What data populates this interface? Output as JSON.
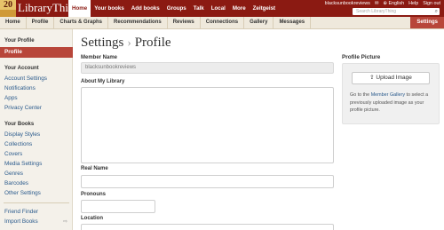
{
  "logo": {
    "number": "20",
    "text": "LibraryThing"
  },
  "topnav": [
    {
      "label": "Home",
      "active": true
    },
    {
      "label": "Your books",
      "active": false
    },
    {
      "label": "Add books",
      "active": false
    },
    {
      "label": "Groups",
      "active": false
    },
    {
      "label": "Talk",
      "active": false
    },
    {
      "label": "Local",
      "active": false
    },
    {
      "label": "More",
      "active": false
    },
    {
      "label": "Zeitgeist",
      "active": false
    }
  ],
  "user_links": {
    "username": "blacksunbookreviews",
    "mail": "✉",
    "language": "English",
    "help": "Help",
    "signout": "Sign out"
  },
  "search": {
    "placeholder": "Search LibraryThing",
    "icon": "search-icon"
  },
  "subnav": [
    "Home",
    "Profile",
    "Charts & Graphs",
    "Recommendations",
    "Reviews",
    "Connections",
    "Gallery",
    "Messages"
  ],
  "subnav_active": "Settings",
  "sidebar": {
    "your_profile": "Your Profile",
    "profile_active": "Profile",
    "your_account": "Your Account",
    "account_items": [
      "Account Settings",
      "Notifications",
      "Apps",
      "Privacy Center"
    ],
    "your_books": "Your Books",
    "books_items": [
      "Display Styles",
      "Collections",
      "Covers",
      "Media Settings",
      "Genres",
      "Barcodes",
      "Other Settings"
    ],
    "tools_items": [
      "Friend Finder",
      "Import Books"
    ],
    "import_arrow": "⇨"
  },
  "page_title": {
    "part1": "Settings",
    "sep": "›",
    "part2": "Profile"
  },
  "form": {
    "member_name_label": "Member Name",
    "member_name_value": "blacksunbookreviews",
    "about_label": "About My Library",
    "real_name_label": "Real Name",
    "pronouns_label": "Pronouns",
    "location_label": "Location"
  },
  "profile_picture": {
    "title": "Profile Picture",
    "upload_icon": "upload-icon",
    "upload_label": "Upload Image",
    "help_pre": "Go to the ",
    "help_link": "Member Gallery",
    "help_post": " to select a previously uploaded image as your profile picture."
  },
  "colors": {
    "brand": "#8b1a12",
    "accent": "#b8463a",
    "link": "#2a5a8c"
  }
}
